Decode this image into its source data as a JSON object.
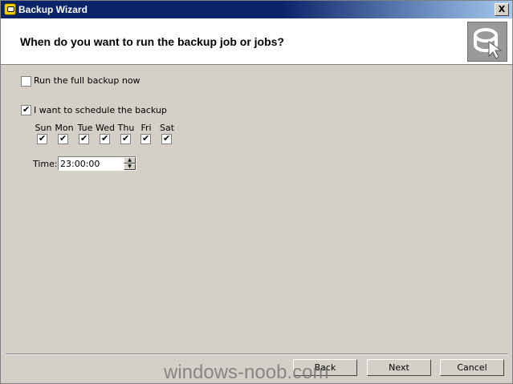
{
  "window": {
    "title": "Backup Wizard",
    "close_label": "X"
  },
  "header": {
    "heading": "When do you want to run the backup job or jobs?"
  },
  "options": {
    "full_backup_label": "Run the full backup now",
    "schedule_label": "I want to schedule the backup"
  },
  "days": [
    {
      "label": "Sun",
      "checked": true
    },
    {
      "label": "Mon",
      "checked": true
    },
    {
      "label": "Tue",
      "checked": true
    },
    {
      "label": "Wed",
      "checked": true
    },
    {
      "label": "Thu",
      "checked": true
    },
    {
      "label": "Fri",
      "checked": true
    },
    {
      "label": "Sat",
      "checked": true
    }
  ],
  "time": {
    "label": "Time:",
    "value": "23:00:00"
  },
  "buttons": {
    "back": "Back",
    "next": "Next",
    "cancel": "Cancel"
  },
  "watermark": "windows-noob.com"
}
